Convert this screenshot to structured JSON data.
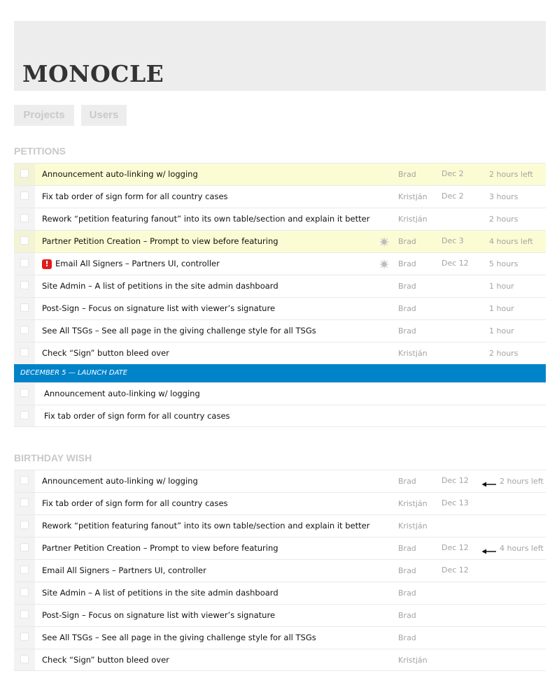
{
  "app": {
    "logo": "MONOCLE"
  },
  "nav": {
    "projects_label": "Projects",
    "users_label": "Users"
  },
  "petitions": {
    "title": "PETITIONS",
    "tasks": [
      {
        "title": "Announcement auto-linking w/ logging",
        "owner": "Brad",
        "date": "Dec 2",
        "estimate": "2 hours left",
        "highlighted": true
      },
      {
        "title": "Fix tab order of sign form for all country cases",
        "owner": "Kristján",
        "date": "Dec 2",
        "estimate": "3 hours"
      },
      {
        "title": "Rework “petition featuring fanout” into its own table/section and explain it better",
        "owner": "Kristján",
        "date": "",
        "estimate": "2 hours"
      },
      {
        "title": "Partner Petition Creation – Prompt to view before featuring",
        "owner": "Brad",
        "date": "Dec 3",
        "estimate": "4 hours left",
        "highlighted": true,
        "splat_icon": "splat-icon"
      },
      {
        "title": "Email All Signers – Partners UI, controller",
        "owner": "Brad",
        "date": "Dec 12",
        "estimate": "5 hours",
        "flag": "!",
        "flag_color": "#e01b1b",
        "splat_icon": "splat-icon"
      },
      {
        "title": "Site Admin – A list of petitions in the site admin dashboard",
        "owner": "Brad",
        "date": "",
        "estimate": "1 hour"
      },
      {
        "title": "Post-Sign – Focus on signature list with viewer’s signature",
        "owner": "Brad",
        "date": "",
        "estimate": "1 hour"
      },
      {
        "title": "See All TSGs – See all page in the giving challenge style for all TSGs",
        "owner": "Brad",
        "date": "",
        "estimate": "1 hour"
      },
      {
        "title": "Check “Sign” button bleed over",
        "owner": "Kristján",
        "date": "",
        "estimate": "2 hours"
      }
    ],
    "launch": {
      "label": "DECEMBER 5 — LAUNCH DATE",
      "color": "#0083c9",
      "tasks": [
        {
          "title": "Announcement auto-linking w/ logging"
        },
        {
          "title": "Fix tab order of sign form for all country cases"
        }
      ]
    }
  },
  "birthday": {
    "title": "BIRTHDAY WISH",
    "tasks": [
      {
        "title": "Announcement auto-linking w/ logging",
        "owner": "Brad",
        "date": "Dec 12",
        "estimate": "2 hours left",
        "arrow_icon": "arrow-left-icon"
      },
      {
        "title": "Fix tab order of sign form for all country cases",
        "owner": "Kristján",
        "date": "Dec 13",
        "estimate": ""
      },
      {
        "title": "Rework “petition featuring fanout” into its own table/section and explain it better",
        "owner": "Kristján",
        "date": "",
        "estimate": ""
      },
      {
        "title": "Partner Petition Creation – Prompt to view before featuring",
        "owner": "Brad",
        "date": "Dec 12",
        "estimate": "4 hours left",
        "arrow_icon": "arrow-left-icon"
      },
      {
        "title": "Email All Signers – Partners UI, controller",
        "owner": "Brad",
        "date": "Dec 12",
        "estimate": ""
      },
      {
        "title": "Site Admin – A list of petitions in the site admin dashboard",
        "owner": "Brad",
        "date": "",
        "estimate": ""
      },
      {
        "title": "Post-Sign – Focus on signature list with viewer’s signature",
        "owner": "Brad",
        "date": "",
        "estimate": ""
      },
      {
        "title": "See All TSGs – See all page in the giving challenge style for all TSGs",
        "owner": "Brad",
        "date": "",
        "estimate": ""
      },
      {
        "title": "Check “Sign” button bleed over",
        "owner": "Kristján",
        "date": "",
        "estimate": ""
      }
    ]
  },
  "colors": {
    "highlight": "#fcfcd4",
    "accent": "#0083c9",
    "flag": "#e01b1b"
  }
}
